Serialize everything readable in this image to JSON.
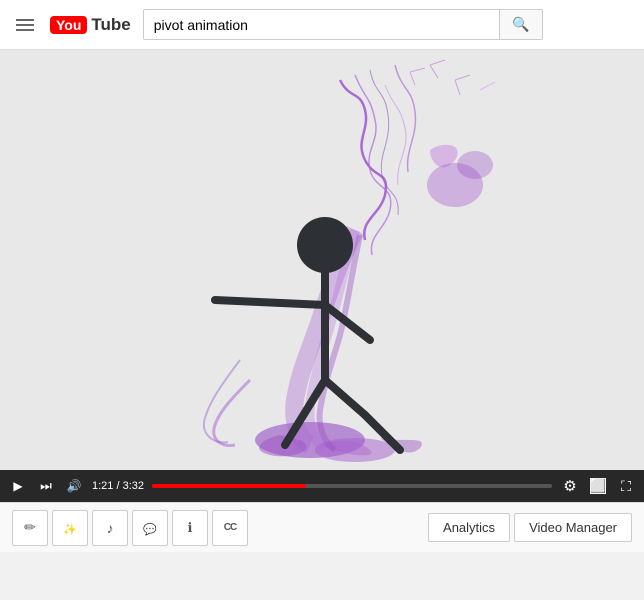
{
  "header": {
    "search_placeholder": "pivot animation",
    "search_value": "pivot animation"
  },
  "video": {
    "current_time": "1:21",
    "total_time": "3:32",
    "progress_percent": 38.5
  },
  "toolbar": {
    "analytics_label": "Analytics",
    "video_manager_label": "Video Manager",
    "tools": [
      {
        "name": "edit",
        "icon": "pencil"
      },
      {
        "name": "enhance",
        "icon": "wand"
      },
      {
        "name": "audio",
        "icon": "music"
      },
      {
        "name": "annotations",
        "icon": "bubble"
      },
      {
        "name": "info",
        "icon": "info"
      },
      {
        "name": "captions",
        "icon": "cc"
      }
    ]
  }
}
